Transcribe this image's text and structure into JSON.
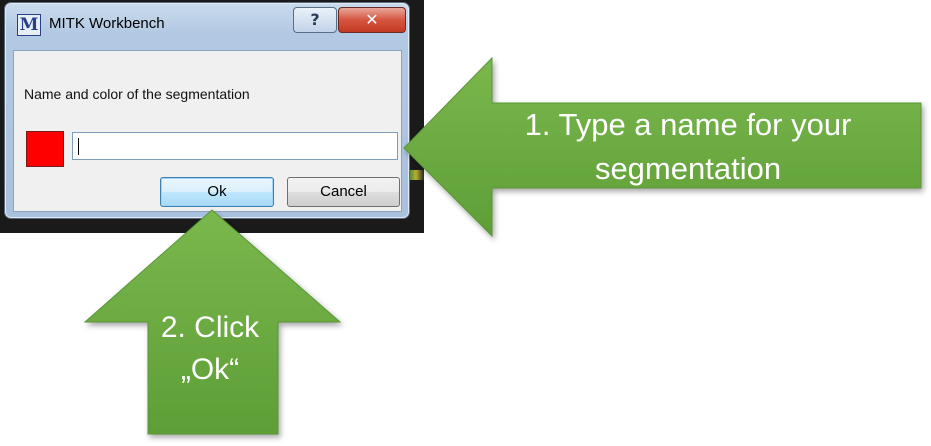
{
  "window": {
    "title": "MITK Workbench",
    "app_icon_glyph": "M",
    "help_glyph": "?",
    "close_glyph": "✕"
  },
  "dialog": {
    "label": "Name and color of the segmentation",
    "color_swatch": "#ff0000",
    "name_value": "",
    "ok_label": "Ok",
    "cancel_label": "Cancel"
  },
  "annotations": {
    "step1_line1": "1. Type a name for your",
    "step1_line2": "segmentation",
    "step2_line1": "2. Click",
    "step2_line2": "„Ok“",
    "arrow_color": "#66a83e"
  }
}
